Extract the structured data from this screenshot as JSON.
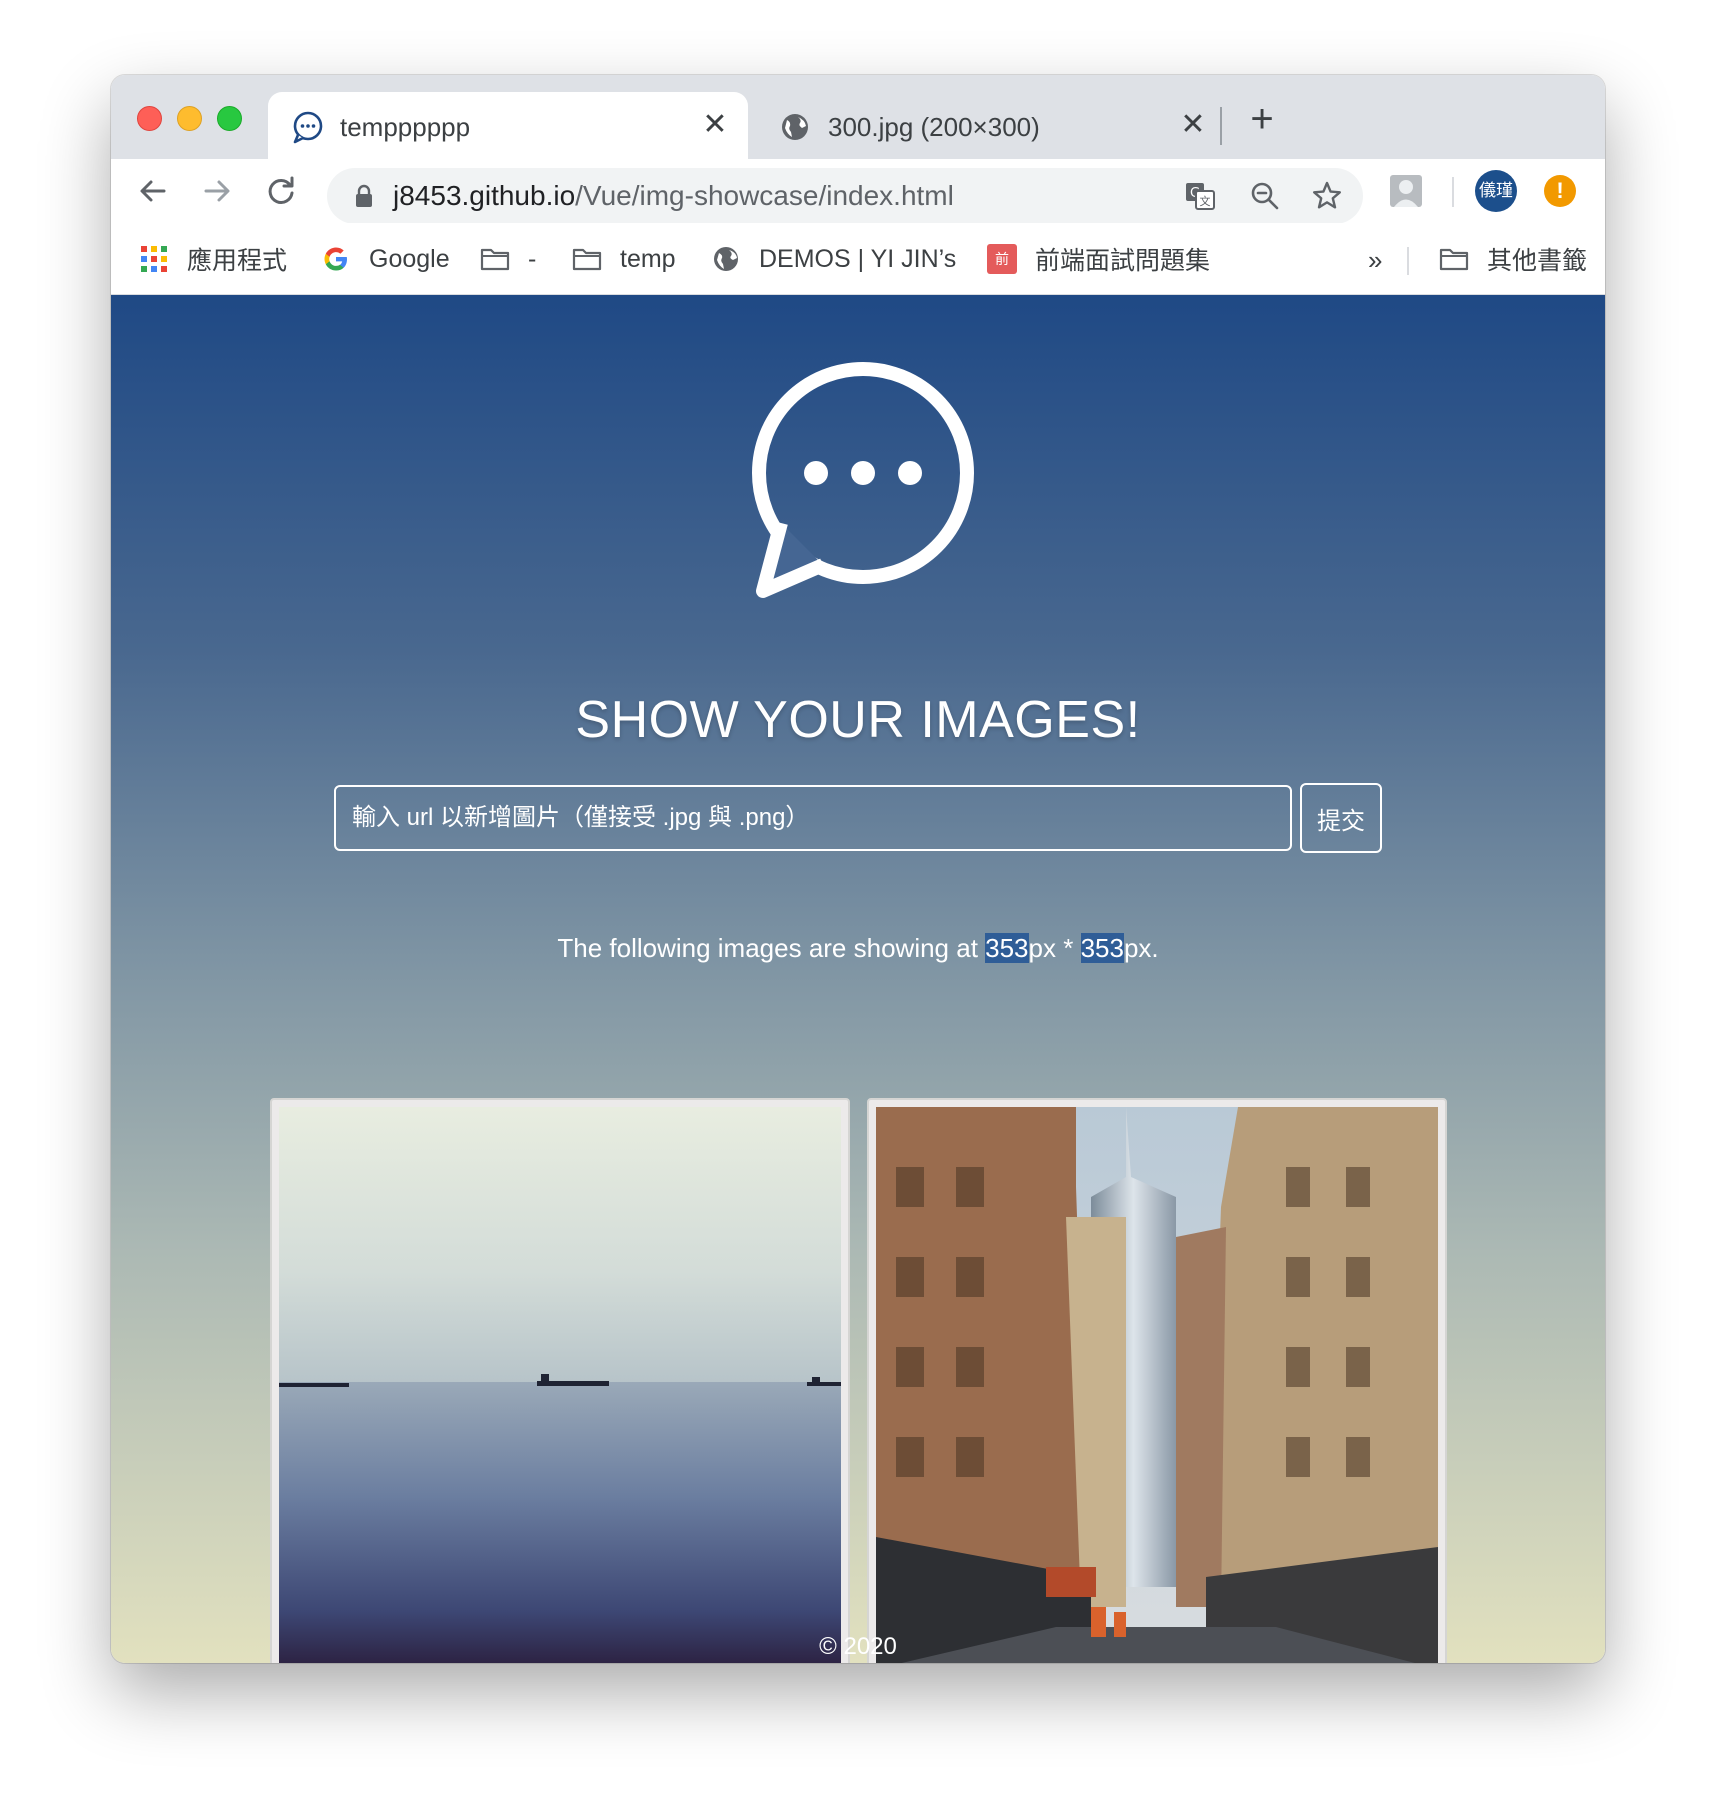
{
  "browser": {
    "tabs": [
      {
        "title": "tempppppp",
        "favicon": "chat-bubble-icon",
        "active": true
      },
      {
        "title": "300.jpg (200×300)",
        "favicon": "globe-icon",
        "active": false
      }
    ],
    "close_glyph": "✕",
    "new_tab_glyph": "+",
    "url_host": "j8453.github.io",
    "url_path": "/Vue/img-showcase/index.html",
    "profile_label": "儀瑾",
    "alert_glyph": "!"
  },
  "bookmarks": {
    "items": [
      {
        "label": "應用程式",
        "icon": "apps-grid-icon"
      },
      {
        "label": "Google",
        "icon": "google-icon"
      },
      {
        "label": "-",
        "icon": "folder-icon"
      },
      {
        "label": "temp",
        "icon": "folder-icon"
      },
      {
        "label": "DEMOS | YI JIN’s",
        "icon": "globe-icon"
      },
      {
        "label": "前端面試問題集",
        "icon": "bookmark-favicon",
        "favicon_text": "前"
      }
    ],
    "more": "»",
    "other": "其他書籤"
  },
  "page": {
    "heading": "SHOW YOUR IMAGES!",
    "input_placeholder": "輸入 url 以新增圖片（僅接受 .jpg 與 .png）",
    "submit_label": "提交",
    "info_prefix": "The following images are showing at ",
    "info_width": "353",
    "info_mid": "px * ",
    "info_height": "353",
    "info_suffix": "px.",
    "footer": "© 2020"
  },
  "colors": {
    "gradient_top": "#1f4985",
    "gradient_bottom": "#e2e1bf",
    "highlight": "#2f5d97",
    "profile_bg": "#1c4f8c",
    "alert_bg": "#f29900"
  }
}
